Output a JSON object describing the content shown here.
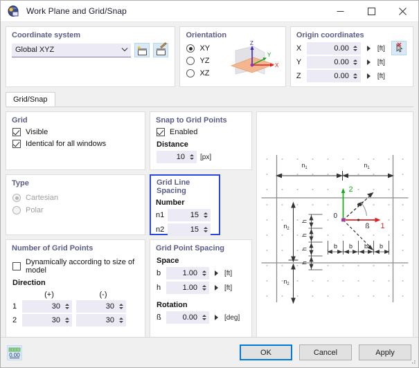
{
  "window": {
    "title": "Work Plane and Grid/Snap",
    "icon": "work-plane-icon",
    "minimize": "—",
    "maximize": "□",
    "close": "✕"
  },
  "coordinate_system": {
    "title": "Coordinate system",
    "value": "Global XYZ",
    "chevron": "⌄",
    "new_button": "new-coordinate-system",
    "edit_button": "edit-coordinate-system"
  },
  "orientation": {
    "title": "Orientation",
    "options": [
      {
        "label": "XY",
        "checked": true
      },
      {
        "label": "YZ",
        "checked": false
      },
      {
        "label": "XZ",
        "checked": false
      }
    ],
    "axis_labels": {
      "x": "X",
      "y": "Y",
      "z": "Z"
    },
    "colors": {
      "x": "#e02020",
      "y": "#14a014",
      "z": "#3a2bb0",
      "plane_xy": "#f3b98a",
      "plane_other": "#d8d8dc"
    }
  },
  "origin": {
    "title": "Origin coordinates",
    "rows": [
      {
        "label": "X",
        "value": "0.00",
        "unit": "[ft]"
      },
      {
        "label": "Y",
        "value": "0.00",
        "unit": "[ft]"
      },
      {
        "label": "Z",
        "value": "0.00",
        "unit": "[ft]"
      }
    ],
    "pick_button": "pick-origin-point"
  },
  "tabs": [
    {
      "label": "Grid/Snap",
      "active": true
    }
  ],
  "grid": {
    "title": "Grid",
    "visible": {
      "label": "Visible",
      "checked": true
    },
    "identical": {
      "label": "Identical for all windows",
      "checked": true
    }
  },
  "type": {
    "title": "Type",
    "options": [
      {
        "label": "Cartesian",
        "checked": true,
        "disabled": true
      },
      {
        "label": "Polar",
        "checked": false,
        "disabled": true
      }
    ]
  },
  "number_of_grid_points": {
    "title": "Number of Grid Points",
    "dynamic": {
      "label": "Dynamically according to size of model",
      "checked": false
    },
    "direction_label": "Direction",
    "col_positive": "(+)",
    "col_negative": "(-)",
    "rows": [
      {
        "index": "1",
        "positive": "30",
        "negative": "30"
      },
      {
        "index": "2",
        "positive": "30",
        "negative": "30"
      }
    ]
  },
  "snap_to_grid_points": {
    "title": "Snap to Grid Points",
    "enabled": {
      "label": "Enabled",
      "checked": true
    },
    "distance_label": "Distance",
    "distance_value": "10",
    "distance_unit": "[px]"
  },
  "grid_line_spacing": {
    "title": "Grid Line Spacing",
    "highlighted": true,
    "highlight_color": "#2948e0",
    "number_label": "Number",
    "rows": [
      {
        "label": "n1",
        "value": "15"
      },
      {
        "label": "n2",
        "value": "15"
      }
    ]
  },
  "grid_point_spacing": {
    "title": "Grid Point Spacing",
    "space_label": "Space",
    "rows": [
      {
        "label": "b",
        "value": "1.00",
        "unit": "[ft]"
      },
      {
        "label": "h",
        "value": "1.00",
        "unit": "[ft]"
      }
    ],
    "rotation_label": "Rotation",
    "rotation": {
      "label": "ß",
      "value": "0.00",
      "unit": "[deg]"
    }
  },
  "diagram": {
    "labels": {
      "n1_left": "n1",
      "n1_right": "n1",
      "n2_top": "n2",
      "n2_bottom": "n2",
      "h": "h",
      "b": "b",
      "origin": "0",
      "axis1": "1",
      "axis2": "2",
      "beta": "ß"
    },
    "colors": {
      "axis1": "#e02020",
      "axis2": "#12b012",
      "grid": "#bbbbbb",
      "line": "#555555"
    }
  },
  "footer": {
    "number_format_button": "number-format",
    "number_format_text": "0.00",
    "buttons": [
      {
        "label": "OK",
        "primary": true
      },
      {
        "label": "Cancel",
        "primary": false
      },
      {
        "label": "Apply",
        "primary": false
      }
    ]
  }
}
